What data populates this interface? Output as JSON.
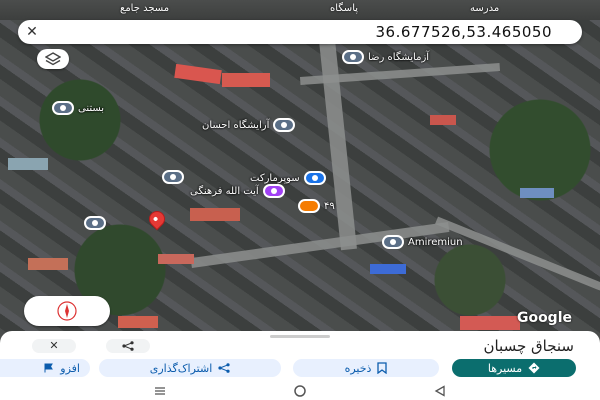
{
  "map": {
    "top_labels": [
      "مسجد جامع",
      "پاسگاه",
      "مدرسه"
    ],
    "pois": [
      {
        "label": "آزمایشگاه رضا",
        "style": "grey"
      },
      {
        "label": "بستنی",
        "style": "grey"
      },
      {
        "label": "آرایشگاه احسان",
        "style": "grey"
      },
      {
        "label": "سوپرمارکت",
        "style": "blue"
      },
      {
        "label": "آیت الله فرهنگی",
        "style": "purple"
      },
      {
        "label": "۴۹",
        "style": "orange"
      },
      {
        "label": "Amiremiun",
        "style": "grey"
      }
    ],
    "google_logo": "Google"
  },
  "search": {
    "close_label": "✕",
    "coordinates": "36.677526,53.465050"
  },
  "sheet": {
    "place_title": "سنجاق چسبان",
    "close_label": "✕",
    "actions": {
      "directions": "مسیرها",
      "save": "ذخیره",
      "share": "اشتراک‌گذاری",
      "add": "افزو"
    }
  },
  "colors": {
    "accent": "#0b6e6e",
    "chip_bg": "#e8f0fe",
    "pin": "#e53935"
  }
}
